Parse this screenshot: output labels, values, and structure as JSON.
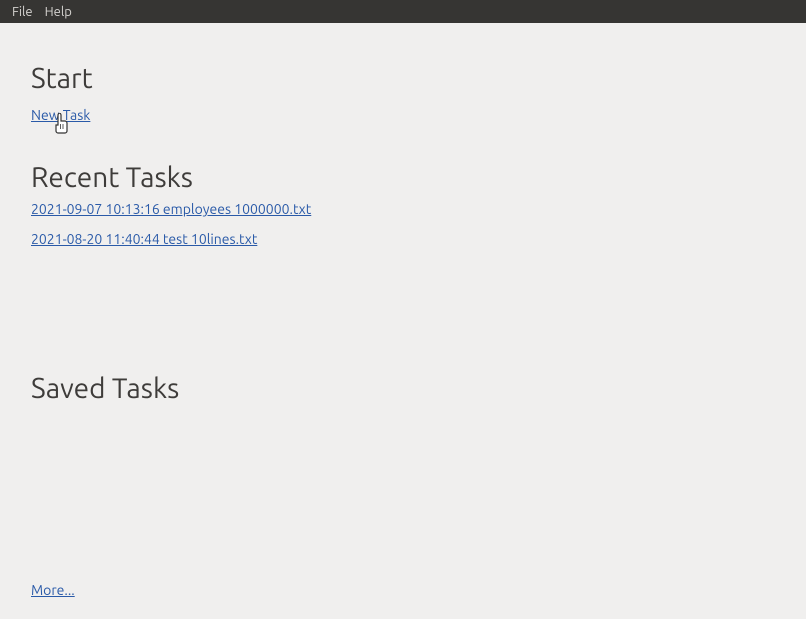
{
  "menubar": {
    "file": "File",
    "help": "Help"
  },
  "sections": {
    "start": {
      "heading": "Start",
      "new_task": "New Task"
    },
    "recent": {
      "heading": "Recent Tasks",
      "items": [
        "2021-09-07 10:13:16  employees  1000000.txt",
        "2021-08-20 11:40:44  test  10lines.txt"
      ]
    },
    "saved": {
      "heading": "Saved Tasks"
    },
    "more": "More..."
  }
}
